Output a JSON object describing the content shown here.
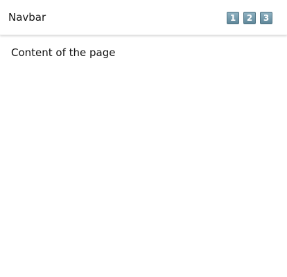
{
  "navbar": {
    "title": "Navbar",
    "items": [
      {
        "label": "1",
        "icon": "keycap-1-icon"
      },
      {
        "label": "2",
        "icon": "keycap-2-icon"
      },
      {
        "label": "3",
        "icon": "keycap-3-icon"
      }
    ]
  },
  "main": {
    "text": "Content of the page"
  }
}
